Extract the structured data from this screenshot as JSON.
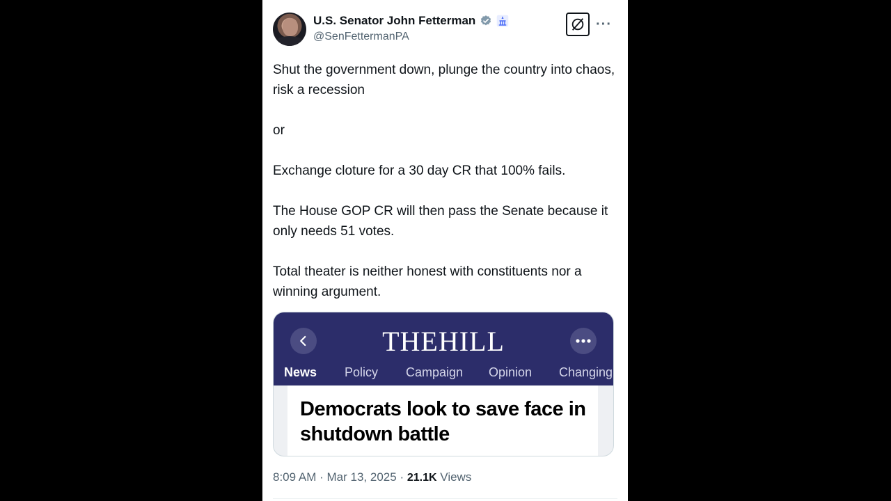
{
  "author": {
    "display_name": "U.S. Senator John Fetterman",
    "handle": "@SenFettermanPA"
  },
  "tweet": {
    "text": "Shut the government down, plunge the country into chaos, risk a recession\n\nor\n\nExchange cloture for a 30 day CR that 100% fails.\n\nThe House GOP CR will then pass the Senate because it only needs 51 votes.\n\nTotal theater is neither honest with constituents nor a winning argument."
  },
  "card": {
    "site_logo": "THEHILL",
    "nav": [
      "News",
      "Policy",
      "Campaign",
      "Opinion",
      "Changing"
    ],
    "headline": "Democrats look to save face in shutdown battle"
  },
  "meta": {
    "time": "8:09 AM",
    "separator": "·",
    "date": "Mar 13, 2025",
    "views_count": "21.1K",
    "views_label": "Views"
  },
  "colors": {
    "verified": "#829aab",
    "gov_badge": "#4a6cf7",
    "site_bar": "#2c2d6a"
  },
  "icons": [
    "verified-badge-icon",
    "government-badge-icon",
    "grok-icon",
    "more-options-icon",
    "chevron-left-icon",
    "ellipsis-icon"
  ]
}
